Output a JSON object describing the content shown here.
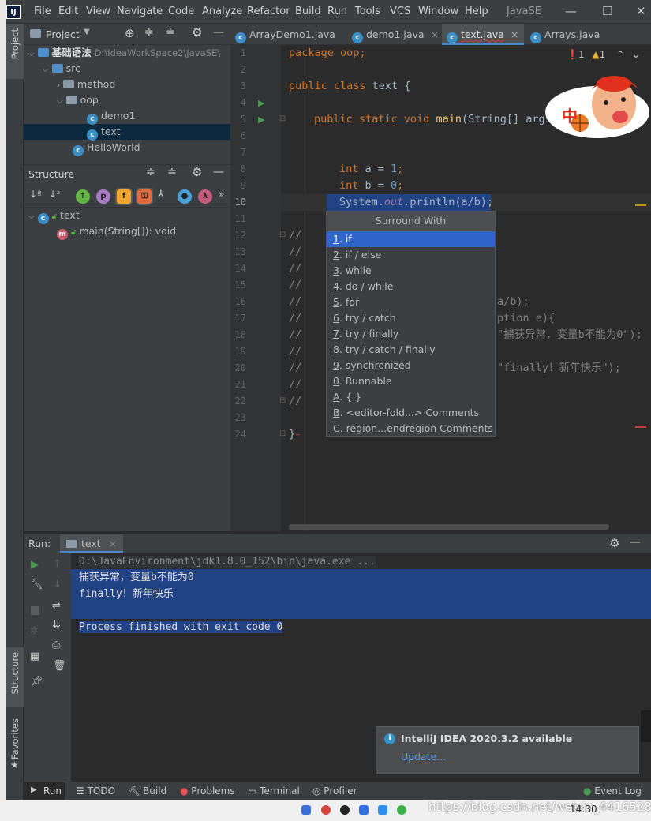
{
  "menubar": {
    "logo": "IJ",
    "items": [
      "File",
      "Edit",
      "View",
      "Navigate",
      "Code",
      "Analyze",
      "Refactor",
      "Build",
      "Run",
      "Tools",
      "VCS",
      "Window",
      "Help"
    ],
    "window_title": "JavaSE",
    "minimize": "—",
    "maximize": "☐",
    "close": "✕"
  },
  "left_stripe": {
    "project": "Project",
    "structure": "Structure",
    "favorites": "Favorites"
  },
  "project_panel": {
    "title": "Project",
    "tree": [
      {
        "label": "基础语法",
        "path": "D:\\IdeaWorkSpace2\\JavaSE\\"
      },
      {
        "label": "src"
      },
      {
        "label": "method"
      },
      {
        "label": "oop"
      },
      {
        "label": "demo1"
      },
      {
        "label": "text"
      },
      {
        "label": "HelloWorld"
      }
    ]
  },
  "structure_panel": {
    "title": "Structure",
    "class_name": "text",
    "method": "main(String[]): void"
  },
  "tabs": [
    {
      "label": "ArrayDemo1.java",
      "close": "×"
    },
    {
      "label": "demo1.java",
      "close": "×"
    },
    {
      "label": "text.java",
      "close": "×"
    },
    {
      "label": "Arrays.java",
      "close": "×"
    }
  ],
  "editor": {
    "inspection": {
      "errors": "1",
      "warnings": "1"
    },
    "line_numbers": [
      "1",
      "2",
      "3",
      "4",
      "5",
      "6",
      "7",
      "8",
      "9",
      "10",
      "11",
      "12",
      "13",
      "14",
      "15",
      "16",
      "17",
      "18",
      "19",
      "20",
      "21",
      "22",
      "23",
      "24"
    ],
    "lines": {
      "l1": [
        "package oop;"
      ],
      "l3a": "public class",
      "l3b": " text {",
      "l5a": "public static void ",
      "l5b": "main",
      "l5c": "(String[] args",
      "l8a": "int",
      "l8b": " a = ",
      "l8c": "1",
      "l8d": ";",
      "l9a": "int",
      "l9b": " b = ",
      "l9c": "0",
      "l9d": ";",
      "l10a": "System.",
      "l10b": "out",
      "l10c": ".println(a/b);",
      "comment": "//",
      "l16tail": "a/b);",
      "l17tail": "ption e){",
      "l18tail": "\"捕获异常，变量b不能为0\");",
      "l20tail": "\"finally！新年快乐\");",
      "l24": "}"
    }
  },
  "popup": {
    "title": "Surround With",
    "items": [
      {
        "key": "1",
        "label": ". if"
      },
      {
        "key": "2",
        "label": ". if / else"
      },
      {
        "key": "3",
        "label": ". while"
      },
      {
        "key": "4",
        "label": ". do / while"
      },
      {
        "key": "5",
        "label": ". for"
      },
      {
        "key": "6",
        "label": ". try / catch"
      },
      {
        "key": "7",
        "label": ". try / finally"
      },
      {
        "key": "8",
        "label": ". try / catch / finally"
      },
      {
        "key": "9",
        "label": ". synchronized"
      },
      {
        "key": "0",
        "label": ". Runnable"
      },
      {
        "key": "A",
        "label": ". { }"
      },
      {
        "key": "B",
        "label": ". <editor-fold...> Comments"
      },
      {
        "key": "C",
        "label": ". region...endregion Comments"
      }
    ]
  },
  "run_panel": {
    "label": "Run:",
    "tab": "text",
    "tab_close": "×",
    "console": [
      "D:\\JavaEnvironment\\jdk1.8.0_152\\bin\\java.exe ...",
      "捕获异常，变量b不能为0",
      "finally！新年快乐",
      "",
      "Process finished with exit code 0"
    ]
  },
  "notification": {
    "title": "IntelliJ IDEA 2020.3.2 available",
    "link": "Update..."
  },
  "bottombar": {
    "run": "Run",
    "todo": "TODO",
    "build": "Build",
    "problems": "Problems",
    "terminal": "Terminal",
    "profiler": "Profiler",
    "event_log": "Event Log"
  },
  "taskbar": {
    "time": "14:30",
    "watermark": "https://blog.csdn.net/weixin_44165280"
  },
  "mascot": {
    "glyph": "中"
  },
  "colors": {
    "accent": "#2f65ca",
    "selection": "#214283",
    "keyword": "#cc7832",
    "number": "#6897bb"
  }
}
